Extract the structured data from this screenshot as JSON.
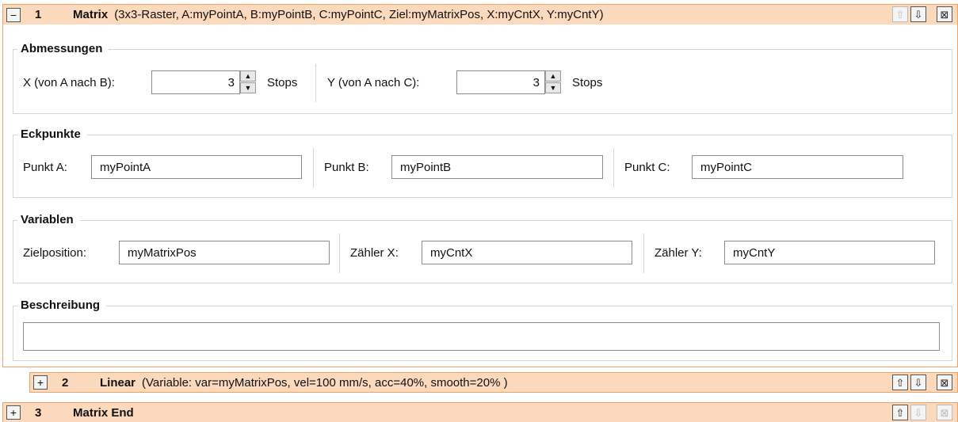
{
  "rows": [
    {
      "toggle": "−",
      "index": "1",
      "title": "Matrix",
      "summary": "(3x3-Raster, A:myPointA, B:myPointB, C:myPointC, Ziel:myMatrixPos, X:myCntX, Y:myCntY)"
    },
    {
      "toggle": "+",
      "index": "2",
      "title": "Linear",
      "summary": "(Variable: var=myMatrixPos, vel=100 mm/s, acc=40%, smooth=20% )"
    },
    {
      "toggle": "+",
      "index": "3",
      "title": "Matrix End",
      "summary": ""
    }
  ],
  "controls": {
    "up": "⇧",
    "down": "⇩",
    "close": "⊠"
  },
  "dimensions": {
    "title": "Abmessungen",
    "x_label": "X (von A nach B):",
    "x_value": "3",
    "y_label": "Y (von A nach C):",
    "y_value": "3",
    "unit": "Stops"
  },
  "corners": {
    "title": "Eckpunkte",
    "a_label": "Punkt A:",
    "a_value": "myPointA",
    "b_label": "Punkt B:",
    "b_value": "myPointB",
    "c_label": "Punkt C:",
    "c_value": "myPointC"
  },
  "variables": {
    "title": "Variablen",
    "target_label": "Zielposition:",
    "target_value": "myMatrixPos",
    "cntx_label": "Zähler X:",
    "cntx_value": "myCntX",
    "cnty_label": "Zähler Y:",
    "cnty_value": "myCntY"
  },
  "description": {
    "title": "Beschreibung",
    "value": ""
  },
  "colors": {
    "header_bg": "#fbd9bd",
    "header_border": "#f0a060"
  }
}
